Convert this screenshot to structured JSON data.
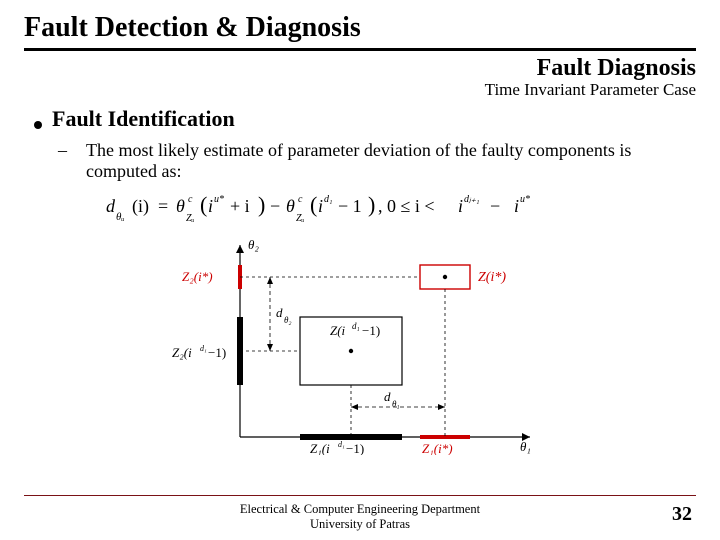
{
  "title": "Fault Detection & Diagnosis",
  "subtitle": "Fault Diagnosis",
  "subtitle_caption": "Time Invariant Parameter Case",
  "bullet1": "Fault Identification",
  "bullet2": "The most likely estimate of parameter deviation of the faulty components is computed as:",
  "formula": {
    "lhs": "d",
    "lhs_sub": "θᵤ",
    "lhs_arg": "(i)",
    "eq": "=",
    "t1": "θ",
    "t1_sup": "c",
    "t1_sub": "Zᵤ",
    "t1_arg_a": "i",
    "t1_arg_a_sup": "u*",
    "t1_plus": "+ i",
    "minus": "−",
    "t2": "θ",
    "t2_sup": "c",
    "t2_sub": "Zᵤ",
    "t2_arg_a": "i",
    "t2_arg_a_sup": "d₁",
    "t2_arg_b": "− 1",
    "range_a": ", 0 ≤ i < ",
    "range_b": "i",
    "range_b_sup": "dⱼ₊₁",
    "range_c": " − ",
    "range_d": "i",
    "range_d_sup": "u*"
  },
  "diagram": {
    "y_axis": "θ₂",
    "x_axis": "θ₁",
    "z2_istar": "Z₂(i*)",
    "z2_id1": "Z₂(i^{d₁}−1)",
    "d_theta2": "d_{θ₂}",
    "d_theta1": "d_{θ₁}",
    "z_id1": "Z(i^{d₁}−1)",
    "z_istar": "Z(i*)",
    "z1_id1": "Z₁(i^{d₁}−1)",
    "z1_istar": "Z₁(i*)"
  },
  "footer_line1": "Electrical & Computer Engineering Department",
  "footer_line2": "University of Patras",
  "page_number": "32"
}
